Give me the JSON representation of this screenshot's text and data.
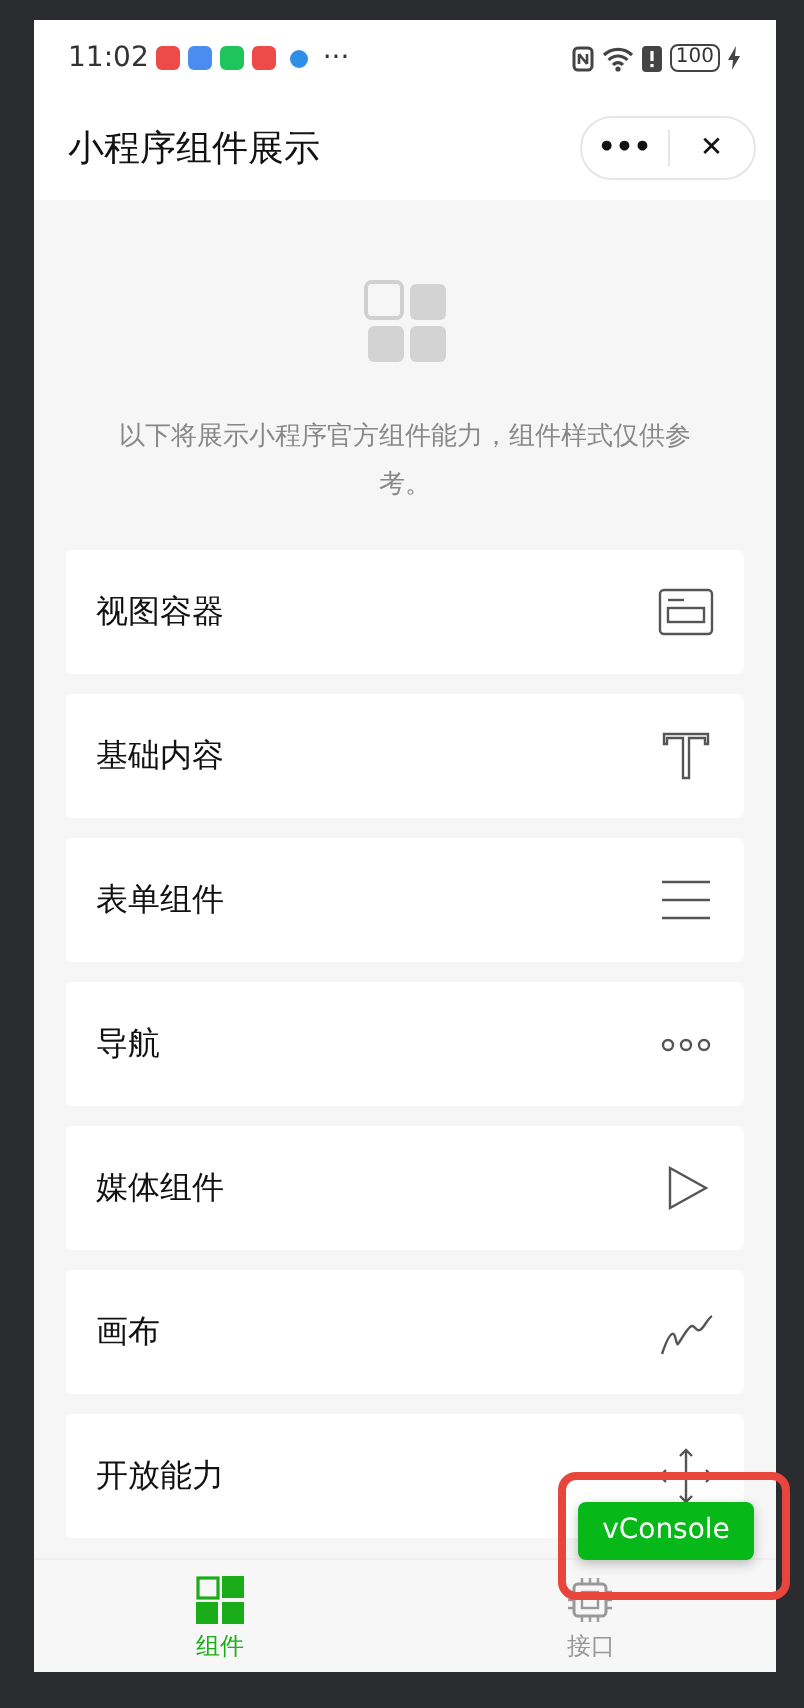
{
  "status_bar": {
    "time": "11:02",
    "more": "···",
    "battery": "100"
  },
  "nav_bar": {
    "title": "小程序组件展示",
    "menu": "•••",
    "close": "✕"
  },
  "intro": "以下将展示小程序官方组件能力，组件样式仅供参考。",
  "items": [
    {
      "label": "视图容器"
    },
    {
      "label": "基础内容"
    },
    {
      "label": "表单组件"
    },
    {
      "label": "导航"
    },
    {
      "label": "媒体组件"
    },
    {
      "label": "画布"
    },
    {
      "label": "开放能力"
    }
  ],
  "tabs": [
    {
      "label": "组件",
      "selected": true
    },
    {
      "label": "接口",
      "selected": false
    }
  ],
  "vconsole": "vConsole"
}
